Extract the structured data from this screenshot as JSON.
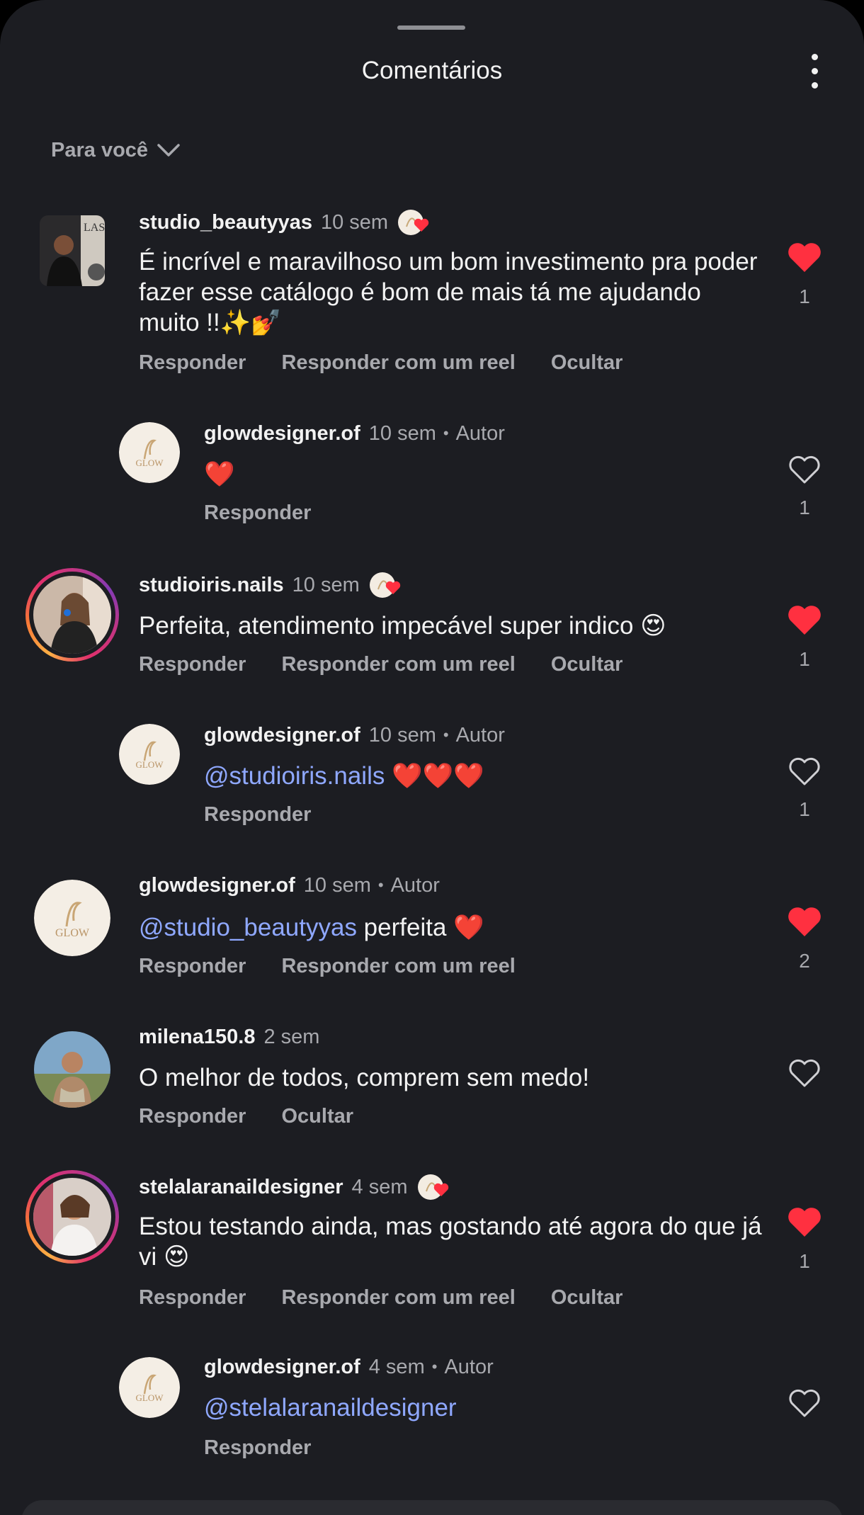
{
  "header": {
    "title": "Comentários"
  },
  "filter": {
    "label": "Para você"
  },
  "icons": {
    "more": "more-vertical-icon",
    "chevron": "chevron-down-icon",
    "like": "heart-icon",
    "liked": "heart-filled-icon",
    "creator_like": "creator-heart-badge-icon"
  },
  "colors": {
    "background": "#1c1d22",
    "text": "#f2f2f2",
    "muted": "#a8a9ae",
    "mention": "#8fa8ff",
    "heart": "#ff3040"
  },
  "comments": [
    {
      "username": "studio_beautyyas",
      "time": "10 sem",
      "creator_liked": true,
      "text": "É incrível e maravilhoso um bom investimento pra poder fazer esse catálogo é bom de mais tá me ajudando muito !!✨💅",
      "actions": [
        "Responder",
        "Responder com um reel",
        "Ocultar"
      ],
      "liked": true,
      "likes": "1"
    },
    {
      "username": "glowdesigner.of",
      "time": "10 sem",
      "author_label": "Autor",
      "text": "❤️",
      "actions": [
        "Responder"
      ],
      "liked": false,
      "likes": "1"
    },
    {
      "username": "studioiris.nails",
      "time": "10 sem",
      "creator_liked": true,
      "text": "Perfeita, atendimento impecável super indico 😍",
      "actions": [
        "Responder",
        "Responder com um reel",
        "Ocultar"
      ],
      "liked": true,
      "likes": "1"
    },
    {
      "username": "glowdesigner.of",
      "time": "10 sem",
      "author_label": "Autor",
      "mention": "@studioiris.nails",
      "text": " ❤️❤️❤️",
      "actions": [
        "Responder"
      ],
      "liked": false,
      "likes": "1"
    },
    {
      "username": "glowdesigner.of",
      "time": "10 sem",
      "author_label": "Autor",
      "mention": "@studio_beautyyas",
      "text": " perfeita ❤️",
      "actions": [
        "Responder",
        "Responder com um reel"
      ],
      "liked": true,
      "likes": "2"
    },
    {
      "username": "milena150.8",
      "time": "2 sem",
      "text": "O melhor de todos, comprem sem medo!",
      "actions": [
        "Responder",
        "Ocultar"
      ],
      "liked": false
    },
    {
      "username": "stelalaranaildesigner",
      "time": "4 sem",
      "creator_liked": true,
      "text": "Estou testando ainda, mas gostando até agora do que já vi 😍",
      "actions": [
        "Responder",
        "Responder com um reel",
        "Ocultar"
      ],
      "liked": true,
      "likes": "1"
    },
    {
      "username": "glowdesigner.of",
      "time": "4 sem",
      "author_label": "Autor",
      "mention": "@stelalaranaildesigner",
      "text": "",
      "actions": [
        "Responder"
      ],
      "liked": false
    }
  ]
}
